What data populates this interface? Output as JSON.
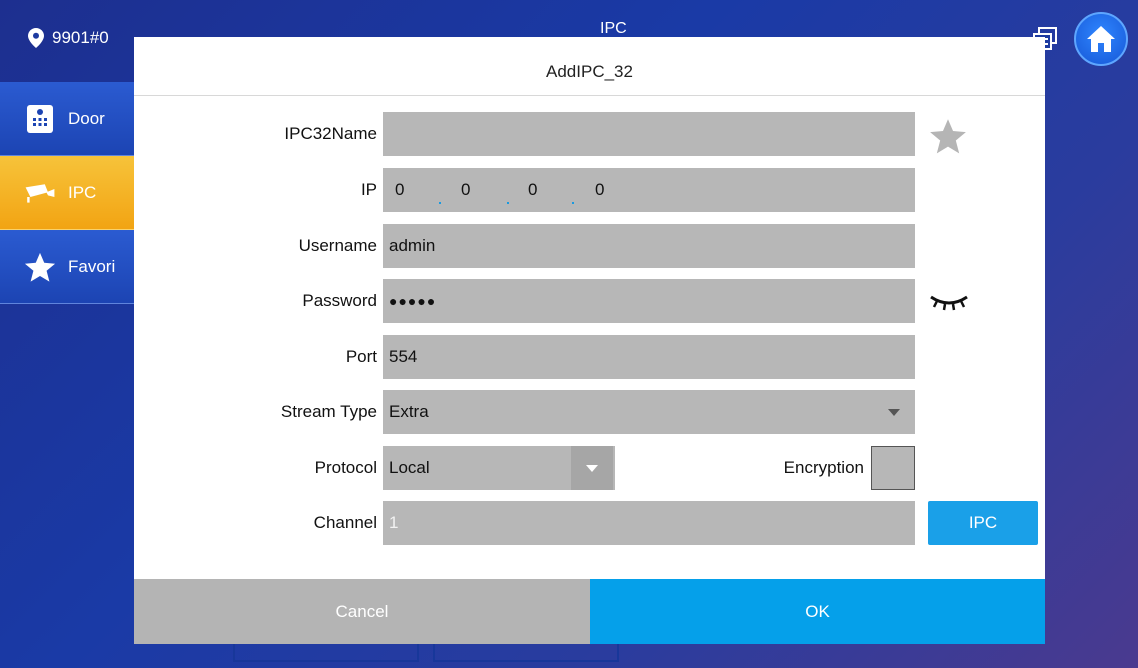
{
  "topbar": {
    "location": "9901#0",
    "title": "IPC"
  },
  "sidebar": {
    "items": [
      {
        "label": "Door",
        "icon": "door-station-icon"
      },
      {
        "label": "IPC",
        "icon": "camera-icon",
        "active": true
      },
      {
        "label": "Favori",
        "icon": "star-icon"
      }
    ]
  },
  "dialog": {
    "title": "AddIPC_32",
    "fields": {
      "name_label": "IPC32Name",
      "name_value": "",
      "ip_label": "IP",
      "ip_octets": [
        "0",
        "0",
        "0",
        "0"
      ],
      "username_label": "Username",
      "username_value": "admin",
      "password_label": "Password",
      "password_value": "●●●●●",
      "port_label": "Port",
      "port_value": "554",
      "stream_type_label": "Stream Type",
      "stream_type_value": "Extra",
      "protocol_label": "Protocol",
      "protocol_value": "Local",
      "encryption_label": "Encryption",
      "encryption_checked": false,
      "channel_label": "Channel",
      "channel_value": "1"
    },
    "ipc_button": "IPC",
    "cancel_button": "Cancel",
    "ok_button": "OK"
  },
  "colors": {
    "accent": "#05a0ea",
    "active_tab": "#f2a413",
    "field_bg": "#b7b7b7",
    "cancel_bg": "#b4b4b4"
  }
}
